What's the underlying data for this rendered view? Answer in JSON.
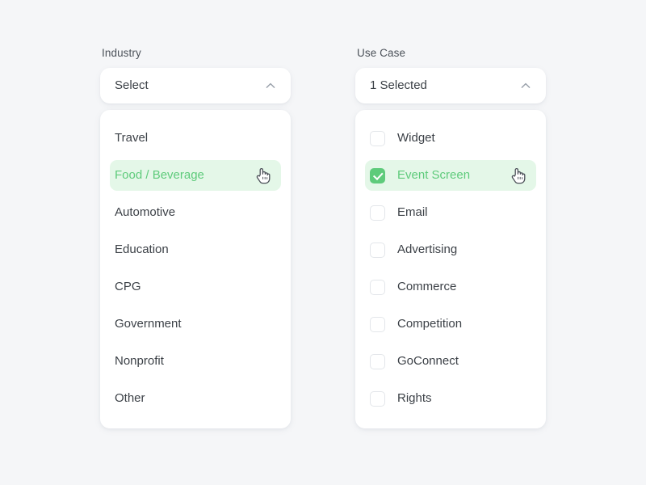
{
  "page": {
    "background_color": "#f5f6f8",
    "accent_green": "#5ecb7b",
    "highlight_green_bg": "#e4f7e8",
    "text_color": "#3c4147"
  },
  "columns": [
    {
      "key": "industry",
      "field_label": "Industry",
      "select_value": "Select",
      "chevron_icon": "chevron-up-icon",
      "has_checkboxes": false,
      "cursor_on_row": 1,
      "options": [
        {
          "label": "Travel",
          "selected": false,
          "checked": false
        },
        {
          "label": "Food / Beverage",
          "selected": true,
          "checked": false
        },
        {
          "label": "Automotive",
          "selected": false,
          "checked": false
        },
        {
          "label": "Education",
          "selected": false,
          "checked": false
        },
        {
          "label": "CPG",
          "selected": false,
          "checked": false
        },
        {
          "label": "Government",
          "selected": false,
          "checked": false
        },
        {
          "label": "Nonprofit",
          "selected": false,
          "checked": false
        },
        {
          "label": "Other",
          "selected": false,
          "checked": false
        }
      ]
    },
    {
      "key": "usecase",
      "field_label": "Use Case",
      "select_value": "1 Selected",
      "chevron_icon": "chevron-up-icon",
      "has_checkboxes": true,
      "cursor_on_row": 1,
      "options": [
        {
          "label": "Widget",
          "selected": false,
          "checked": false
        },
        {
          "label": "Event Screen",
          "selected": true,
          "checked": true
        },
        {
          "label": "Email",
          "selected": false,
          "checked": false
        },
        {
          "label": "Advertising",
          "selected": false,
          "checked": false
        },
        {
          "label": "Commerce",
          "selected": false,
          "checked": false
        },
        {
          "label": "Competition",
          "selected": false,
          "checked": false
        },
        {
          "label": "GoConnect",
          "selected": false,
          "checked": false
        },
        {
          "label": "Rights",
          "selected": false,
          "checked": false
        }
      ]
    }
  ]
}
